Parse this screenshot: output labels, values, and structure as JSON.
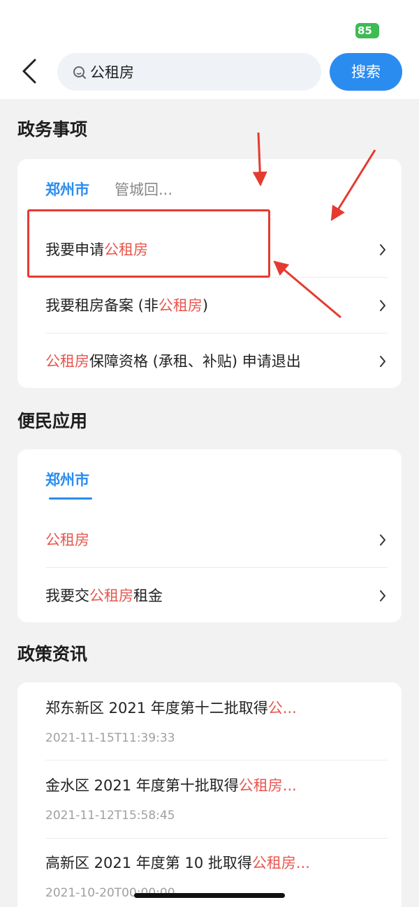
{
  "status": {
    "battery": "85"
  },
  "search": {
    "query": "公租房",
    "button": "搜索"
  },
  "sections": {
    "gov": {
      "title": "政务事项",
      "tabs": [
        "郑州市",
        "管城回..."
      ],
      "rows": [
        {
          "pre": "我要申请",
          "hl": "公租房",
          "post": ""
        },
        {
          "pre": "我要租房备案 (非",
          "hl": "公租房",
          "post": ")"
        },
        {
          "pre": "",
          "hl": "公租房",
          "post": "保障资格 (承租、补贴) 申请退出"
        }
      ]
    },
    "apps": {
      "title": "便民应用",
      "tab": "郑州市",
      "rows": [
        {
          "pre": "",
          "hl": "公租房",
          "post": ""
        },
        {
          "pre": "我要交",
          "hl": "公租房",
          "post": "租金"
        }
      ]
    },
    "news": {
      "title": "政策资讯",
      "items": [
        {
          "pre": "郑东新区 2021 年度第十二批取得",
          "hl": "公...",
          "date": "2021-11-15T11:39:33"
        },
        {
          "pre": "金水区 2021 年度第十批取得",
          "hl": "公租房...",
          "date": "2021-11-12T15:58:45"
        },
        {
          "pre": "高新区 2021 年度第 10 批取得",
          "hl": "公租房...",
          "date": "2021-10-20T00:00:00"
        }
      ]
    }
  },
  "colors": {
    "accent": "#2b8cf0",
    "highlight": "#e8574f",
    "annotation": "#e53a2f"
  },
  "icons": {
    "back": "chevron-left-icon",
    "search": "search-icon",
    "row": "chevron-right-icon"
  }
}
